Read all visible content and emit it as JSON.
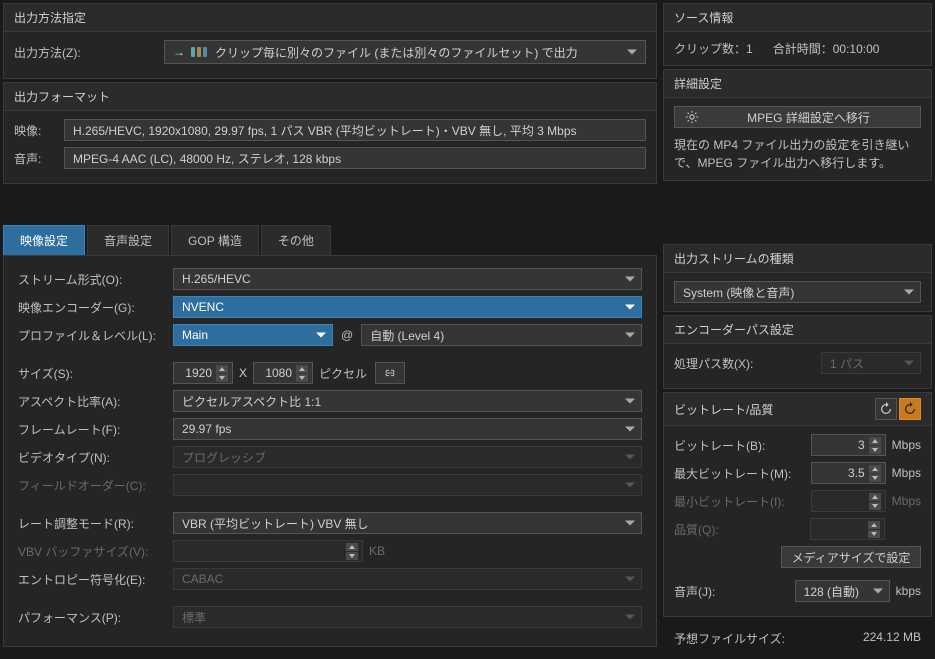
{
  "output_method": {
    "header": "出力方法指定",
    "label": "出力方法(Z):",
    "value": "クリップ毎に別々のファイル (または別々のファイルセット) で出力"
  },
  "source_info": {
    "header": "ソース情報",
    "clip_count_label": "クリップ数：",
    "clip_count": "1",
    "total_time_label": "合計時間：",
    "total_time": "00:10:00"
  },
  "output_format": {
    "header": "出力フォーマット",
    "video_label": "映像:",
    "video_value": "H.265/HEVC, 1920x1080, 29.97 fps, 1 パス VBR (平均ビットレート)・VBV 無し, 平均 3 Mbps",
    "audio_label": "音声:",
    "audio_value": "MPEG-4 AAC (LC), 48000 Hz, ステレオ, 128 kbps"
  },
  "advanced": {
    "header": "詳細設定",
    "button": "MPEG 詳細設定へ移行",
    "desc": "現在の MP4 ファイル出力の設定を引き継いで、MPEG ファイル出力へ移行します。"
  },
  "tabs": {
    "video": "映像設定",
    "audio": "音声設定",
    "gop": "GOP 構造",
    "other": "その他"
  },
  "video_settings": {
    "stream_type_label": "ストリーム形式(O):",
    "stream_type": "H.265/HEVC",
    "encoder_label": "映像エンコーダー(G):",
    "encoder": "NVENC",
    "profile_label": "プロファイル＆レベル(L):",
    "profile": "Main",
    "level": "自動 (Level 4)",
    "size_label": "サイズ(S):",
    "width": "1920",
    "height": "1080",
    "size_unit": "ピクセル",
    "x": "X",
    "aspect_label": "アスペクト比率(A):",
    "aspect": "ピクセルアスペクト比 1:1",
    "framerate_label": "フレームレート(F):",
    "framerate": "29.97 fps",
    "videotype_label": "ビデオタイプ(N):",
    "videotype": "プログレッシブ",
    "fieldorder_label": "フィールドオーダー(C):",
    "ratecontrol_label": "レート調整モード(R):",
    "ratecontrol": "VBR (平均ビットレート) VBV 無し",
    "vbvbuffer_label": "VBV バッファサイズ(V):",
    "vbvbuffer_unit": "KB",
    "entropy_label": "エントロピー符号化(E):",
    "entropy": "CABAC",
    "performance_label": "パフォーマンス(P):",
    "performance": "標準"
  },
  "output_stream": {
    "header": "出力ストリームの種類",
    "value": "System (映像と音声)"
  },
  "encoder_pass": {
    "header": "エンコーダーパス設定",
    "label": "処理パス数(X):",
    "value": "1 パス"
  },
  "bitrate": {
    "header": "ビットレート/品質",
    "bitrate_label": "ビットレート(B):",
    "bitrate": "3",
    "max_label": "最大ビットレート(M):",
    "max": "3.5",
    "min_label": "最小ビットレート(I):",
    "quality_label": "品質(Q):",
    "unit": "Mbps",
    "media_button": "メディアサイズで設定",
    "audio_label": "音声(J):",
    "audio_value": "128 (自動)",
    "audio_unit": "kbps"
  },
  "predicted": {
    "label": "予想ファイルサイズ:",
    "value": "224.12 MB"
  }
}
